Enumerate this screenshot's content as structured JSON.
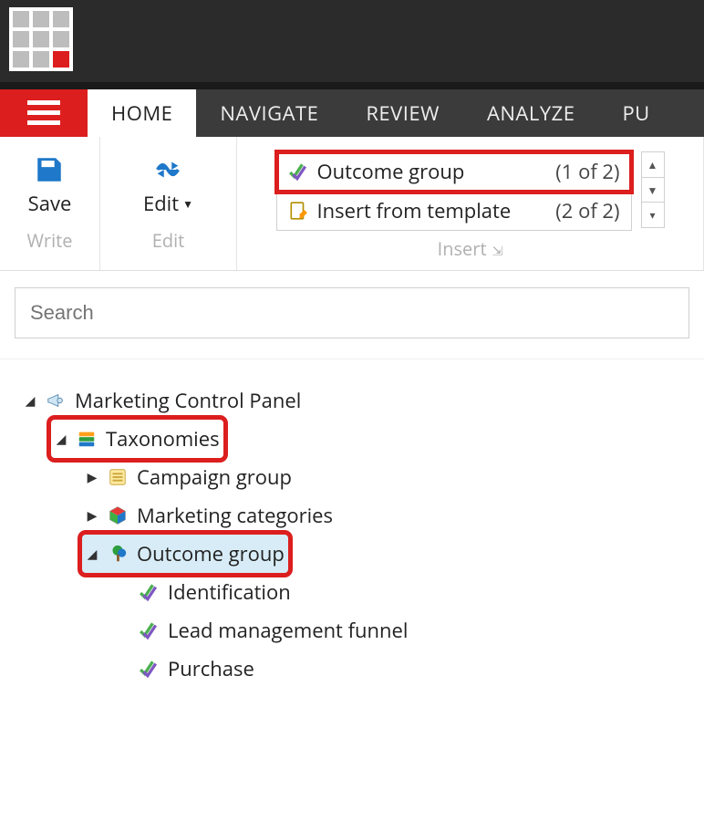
{
  "nav": {
    "tabs": [
      "HOME",
      "NAVIGATE",
      "REVIEW",
      "ANALYZE",
      "PU"
    ],
    "active": 0
  },
  "ribbon": {
    "write": {
      "save_label": "Save",
      "group_title": "Write"
    },
    "edit": {
      "edit_label": "Edit",
      "group_title": "Edit"
    },
    "insert": {
      "group_title": "Insert",
      "rows": [
        {
          "label": "Outcome group",
          "count": "(1 of 2)",
          "highlight": true
        },
        {
          "label": "Insert from template",
          "count": "(2 of 2)",
          "highlight": false
        }
      ]
    }
  },
  "search": {
    "placeholder": "Search"
  },
  "tree": {
    "root": {
      "label": "Marketing Control Panel"
    },
    "taxonomies": {
      "label": "Taxonomies",
      "children": {
        "campaign_group": {
          "label": "Campaign group"
        },
        "marketing_categories": {
          "label": "Marketing categories"
        },
        "outcome_group": {
          "label": "Outcome group",
          "children": {
            "identification": {
              "label": "Identification"
            },
            "lead_management_funnel": {
              "label": "Lead management funnel"
            },
            "purchase": {
              "label": "Purchase"
            }
          }
        }
      }
    }
  }
}
